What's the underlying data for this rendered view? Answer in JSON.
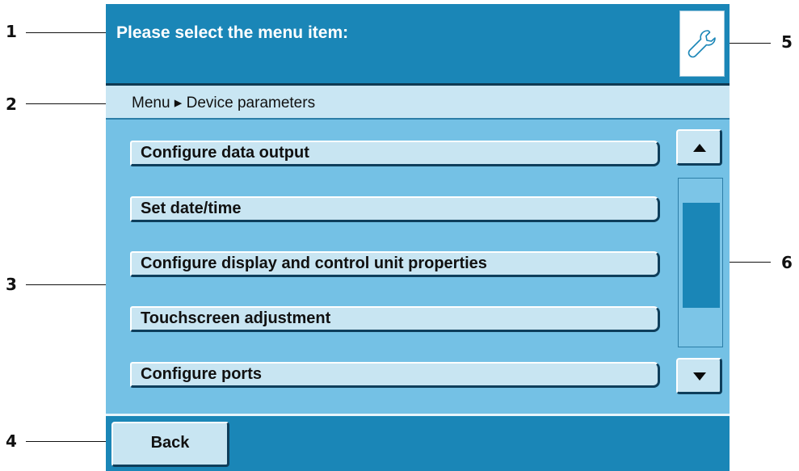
{
  "callouts": [
    "1",
    "2",
    "3",
    "4",
    "5",
    "6"
  ],
  "header": {
    "title": "Please select the menu item:"
  },
  "breadcrumb": {
    "text": "Menu ▸ Device parameters"
  },
  "menu": {
    "items": [
      {
        "label": "Configure data output"
      },
      {
        "label": "Set date/time"
      },
      {
        "label": "Configure display and control unit properties"
      },
      {
        "label": "Touchscreen adjustment"
      },
      {
        "label": "Configure ports"
      }
    ]
  },
  "scrollbar": {
    "up_icon": "triangle-up-icon",
    "down_icon": "triangle-down-icon"
  },
  "toolbar": {
    "tool_icon": "wrench-icon"
  },
  "footer": {
    "back_label": "Back"
  },
  "colors": {
    "header_bg": "#1a86b7",
    "breadcrumb_bg": "#c9e6f3",
    "list_bg": "#74c1e5",
    "button_bg": "#c8e5f2",
    "button_shadow": "#0e3e5b"
  }
}
